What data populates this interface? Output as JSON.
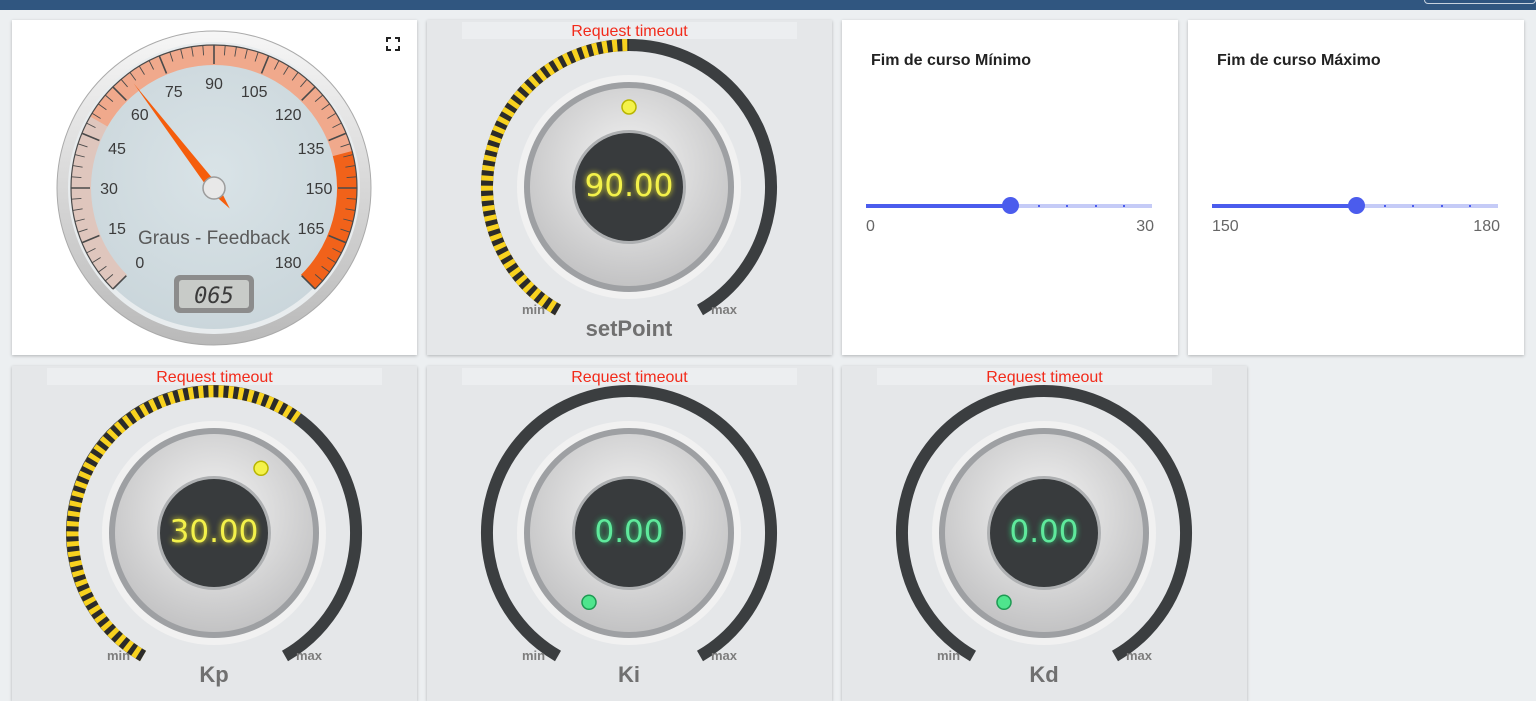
{
  "colors": {
    "header": "#305680",
    "timeout_text": "#f22a1a",
    "knob_value_active": "#f3f14a",
    "knob_value_zero": "#5fe99c",
    "slider_accent": "#4b5ced",
    "gauge_needle": "#f55d0c"
  },
  "gauge": {
    "label": "Graus - Feedback",
    "lcd": "065",
    "value": 65,
    "min": 0,
    "max": 180,
    "ticks": [
      "0",
      "15",
      "30",
      "45",
      "60",
      "75",
      "90",
      "105",
      "120",
      "135",
      "150",
      "165",
      "180"
    ],
    "icon": "expand-icon"
  },
  "knobs": {
    "setpoint": {
      "status": "Request timeout",
      "value": "90.00",
      "fraction": 0.5,
      "min_label": "min",
      "max_label": "max",
      "name": "setPoint"
    },
    "kp": {
      "status": "Request timeout",
      "value": "30.00",
      "fraction": 0.62,
      "min_label": "min",
      "max_label": "max",
      "name": "Kp"
    },
    "ki": {
      "status": "Request timeout",
      "value": "0.00",
      "fraction": 0.0,
      "min_label": "min",
      "max_label": "max",
      "name": "Ki"
    },
    "kd": {
      "status": "Request timeout",
      "value": "0.00",
      "fraction": 0.0,
      "min_label": "min",
      "max_label": "max",
      "name": "Kd"
    }
  },
  "sliders": {
    "min_limit": {
      "title": "Fim de curso Mínimo",
      "min": "0",
      "max": "30",
      "fraction": 0.5
    },
    "max_limit": {
      "title": "Fim de curso Máximo",
      "min": "150",
      "max": "180",
      "fraction": 0.5
    }
  }
}
